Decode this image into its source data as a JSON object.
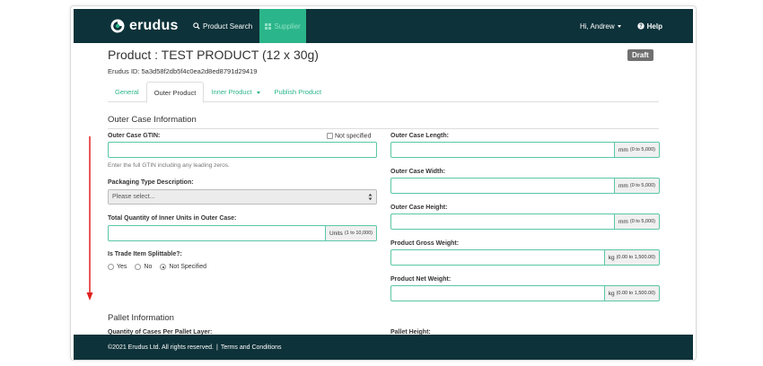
{
  "nav": {
    "logo_text": "erudus",
    "search_label": "Product Search",
    "supplier_label": "Supplier",
    "user_label": "Hi, Andrew",
    "help_label": "Help"
  },
  "product": {
    "title": "Product : TEST PRODUCT (12 x 30g)",
    "id_text": "Erudus ID: 5a3d58f2db5f4c0ea2d8ed8791d29419",
    "status_badge": "Draft"
  },
  "tabs": [
    {
      "label": "General"
    },
    {
      "label": "Outer Product"
    },
    {
      "label": "Inner Product"
    },
    {
      "label": "Publish Product"
    }
  ],
  "outer_case": {
    "section_title": "Outer Case Information",
    "gtin_label": "Outer Case GTIN:",
    "not_specified_label": "Not specified",
    "gtin_value": "",
    "gtin_help": "Enter the full GTIN including any leading zeros.",
    "packaging_label": "Packaging Type Description:",
    "packaging_selected": "Please select...",
    "quantity_label": "Total Quantity of Inner Units in Outer Case:",
    "quantity_unit": "Units",
    "quantity_range": "(1 to 10,000)",
    "splittable_label": "Is Trade Item Splittable?:",
    "splittable_options": [
      "Yes",
      "No",
      "Not Specified"
    ],
    "splittable_selected": "Not Specified",
    "length_label": "Outer Case Length:",
    "width_label": "Outer Case Width:",
    "height_label": "Outer Case Height:",
    "dim_unit": "mm",
    "dim_range": "(0 to 5,000)",
    "gross_weight_label": "Product Gross Weight:",
    "net_weight_label": "Product Net Weight:",
    "weight_unit": "kg",
    "weight_range": "(0.00 to 1,500.00)"
  },
  "pallet": {
    "section_title": "Pallet Information",
    "cases_per_layer_label": "Quantity of Cases Per Pallet Layer:",
    "pallet_height_label": "Pallet Height:"
  },
  "footer": {
    "copyright": "©2021 Erudus Ltd. All rights reserved.",
    "separator": "|",
    "terms": "Terms and Conditions"
  },
  "colors": {
    "navbar": "#0d3239",
    "accent": "#2bb58a",
    "annotation_arrow": "#e02020"
  }
}
